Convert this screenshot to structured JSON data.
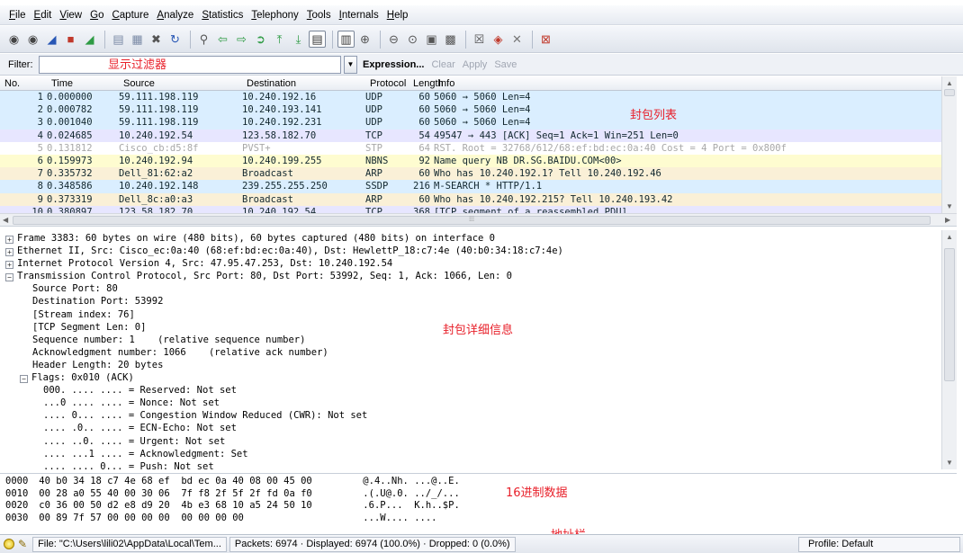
{
  "menu": [
    "File",
    "Edit",
    "View",
    "Go",
    "Capture",
    "Analyze",
    "Statistics",
    "Telephony",
    "Tools",
    "Internals",
    "Help"
  ],
  "toolbar": {
    "icons": [
      "interface-list-icon",
      "options-icon",
      "start-capture-icon",
      "stop-capture-icon",
      "restart-capture-icon",
      "open-file-icon",
      "save-file-icon",
      "close-file-icon",
      "reload-icon",
      "find-icon",
      "back-icon",
      "forward-icon",
      "go-to-packet-icon",
      "first-packet-icon",
      "last-packet-icon",
      "colorize-icon",
      "autoscroll-icon",
      "zoom-in-icon",
      "zoom-out-icon",
      "normal-size-icon",
      "resize-columns-icon",
      "capture-filters-icon",
      "display-filters-icon",
      "coloring-rules-icon",
      "preferences-icon",
      "help-icon"
    ]
  },
  "filter": {
    "label": "Filter:",
    "value": "",
    "expression": "Expression...",
    "clear": "Clear",
    "apply": "Apply",
    "save": "Save"
  },
  "annotations": {
    "filter": "显示过滤器",
    "packet_list": "封包列表",
    "details": "封包详细信息",
    "hex": "16进制数据",
    "address": "地址栏"
  },
  "packet_list": {
    "columns": [
      "No.",
      "Time",
      "Source",
      "Destination",
      "Protocol",
      "Length",
      "Info"
    ],
    "rows": [
      {
        "no": "1",
        "time": "0.000000",
        "src": "59.111.198.119",
        "dst": "10.240.192.16",
        "proto": "UDP",
        "len": "60",
        "info": "5060 → 5060 Len=4",
        "bg": "#daeeff",
        "fg": "#12272e"
      },
      {
        "no": "2",
        "time": "0.000782",
        "src": "59.111.198.119",
        "dst": "10.240.193.141",
        "proto": "UDP",
        "len": "60",
        "info": "5060 → 5060 Len=4",
        "bg": "#daeeff",
        "fg": "#12272e"
      },
      {
        "no": "3",
        "time": "0.001040",
        "src": "59.111.198.119",
        "dst": "10.240.192.231",
        "proto": "UDP",
        "len": "60",
        "info": "5060 → 5060 Len=4",
        "bg": "#daeeff",
        "fg": "#12272e"
      },
      {
        "no": "4",
        "time": "0.024685",
        "src": "10.240.192.54",
        "dst": "123.58.182.70",
        "proto": "TCP",
        "len": "54",
        "info": "49547 → 443 [ACK] Seq=1 Ack=1 Win=251 Len=0",
        "bg": "#e7e6ff",
        "fg": "#12272e"
      },
      {
        "no": "5",
        "time": "0.131812",
        "src": "Cisco_cb:d5:8f",
        "dst": "PVST+",
        "proto": "STP",
        "len": "64",
        "info": "RST. Root = 32768/612/68:ef:bd:ec:0a:40  Cost = 4  Port = 0x800f",
        "bg": "#ffffff",
        "fg": "#a8a8a8"
      },
      {
        "no": "6",
        "time": "0.159973",
        "src": "10.240.192.94",
        "dst": "10.240.199.255",
        "proto": "NBNS",
        "len": "92",
        "info": "Name query NB DR.SG.BAIDU.COM<00>",
        "bg": "#fefcd0",
        "fg": "#12272e"
      },
      {
        "no": "7",
        "time": "0.335732",
        "src": "Dell_81:62:a2",
        "dst": "Broadcast",
        "proto": "ARP",
        "len": "60",
        "info": "Who has 10.240.192.1? Tell 10.240.192.46",
        "bg": "#faf0d7",
        "fg": "#12272e"
      },
      {
        "no": "8",
        "time": "0.348586",
        "src": "10.240.192.148",
        "dst": "239.255.255.250",
        "proto": "SSDP",
        "len": "216",
        "info": "M-SEARCH * HTTP/1.1",
        "bg": "#daeeff",
        "fg": "#12272e"
      },
      {
        "no": "9",
        "time": "0.373319",
        "src": "Dell_8c:a0:a3",
        "dst": "Broadcast",
        "proto": "ARP",
        "len": "60",
        "info": "Who has 10.240.192.215? Tell 10.240.193.42",
        "bg": "#faf0d7",
        "fg": "#12272e"
      },
      {
        "no": "10",
        "time": "0.380897",
        "src": "123.58.182.70",
        "dst": "10.240.192.54",
        "proto": "TCP",
        "len": "368",
        "info": "[TCP segment of a reassembled PDU]",
        "bg": "#e7e6ff",
        "fg": "#12272e"
      }
    ]
  },
  "details": {
    "rows": [
      {
        "indent": 0,
        "exp": "+",
        "text": "Frame 3383: 60 bytes on wire (480 bits), 60 bytes captured (480 bits) on interface 0"
      },
      {
        "indent": 0,
        "exp": "+",
        "text": "Ethernet II, Src: Cisco_ec:0a:40 (68:ef:bd:ec:0a:40), Dst: HewlettP_18:c7:4e (40:b0:34:18:c7:4e)"
      },
      {
        "indent": 0,
        "exp": "+",
        "text": "Internet Protocol Version 4, Src: 47.95.47.253, Dst: 10.240.192.54"
      },
      {
        "indent": 0,
        "exp": "-",
        "text": "Transmission Control Protocol, Src Port: 80, Dst Port: 53992, Seq: 1, Ack: 1066, Len: 0"
      },
      {
        "indent": 1,
        "exp": "",
        "text": "Source Port: 80"
      },
      {
        "indent": 1,
        "exp": "",
        "text": "Destination Port: 53992"
      },
      {
        "indent": 1,
        "exp": "",
        "text": "[Stream index: 76]"
      },
      {
        "indent": 1,
        "exp": "",
        "text": "[TCP Segment Len: 0]"
      },
      {
        "indent": 1,
        "exp": "",
        "text": "Sequence number: 1    (relative sequence number)"
      },
      {
        "indent": 1,
        "exp": "",
        "text": "Acknowledgment number: 1066    (relative ack number)"
      },
      {
        "indent": 1,
        "exp": "",
        "text": "Header Length: 20 bytes"
      },
      {
        "indent": 1,
        "exp": "-",
        "text": "Flags: 0x010 (ACK)"
      },
      {
        "indent": 2,
        "exp": "",
        "text": "000. .... .... = Reserved: Not set"
      },
      {
        "indent": 2,
        "exp": "",
        "text": "...0 .... .... = Nonce: Not set"
      },
      {
        "indent": 2,
        "exp": "",
        "text": ".... 0... .... = Congestion Window Reduced (CWR): Not set"
      },
      {
        "indent": 2,
        "exp": "",
        "text": ".... .0.. .... = ECN-Echo: Not set"
      },
      {
        "indent": 2,
        "exp": "",
        "text": ".... ..0. .... = Urgent: Not set"
      },
      {
        "indent": 2,
        "exp": "",
        "text": ".... ...1 .... = Acknowledgment: Set"
      },
      {
        "indent": 2,
        "exp": "",
        "text": ".... .... 0... = Push: Not set"
      }
    ]
  },
  "hex": {
    "rows": [
      {
        "off": "0000",
        "bytes": "40 b0 34 18 c7 4e 68 ef  bd ec 0a 40 08 00 45 00",
        "ascii": "@.4..Nh. ...@..E."
      },
      {
        "off": "0010",
        "bytes": "00 28 a0 55 40 00 30 06  7f f8 2f 5f 2f fd 0a f0",
        "ascii": ".(.U@.0. ../_/..."
      },
      {
        "off": "0020",
        "bytes": "c0 36 00 50 d2 e8 d9 20  4b e3 68 10 a5 24 50 10",
        "ascii": ".6.P...  K.h..$P."
      },
      {
        "off": "0030",
        "bytes": "00 89 7f 57 00 00 00 00  00 00 00 00",
        "ascii": "...W.... ...."
      }
    ]
  },
  "status": {
    "file": "File: \"C:\\Users\\lili02\\AppData\\Local\\Tem...",
    "packets": "Packets: 6974 · Displayed: 6974 (100.0%)  · Dropped: 0 (0.0%)",
    "profile": "Profile: Default"
  }
}
